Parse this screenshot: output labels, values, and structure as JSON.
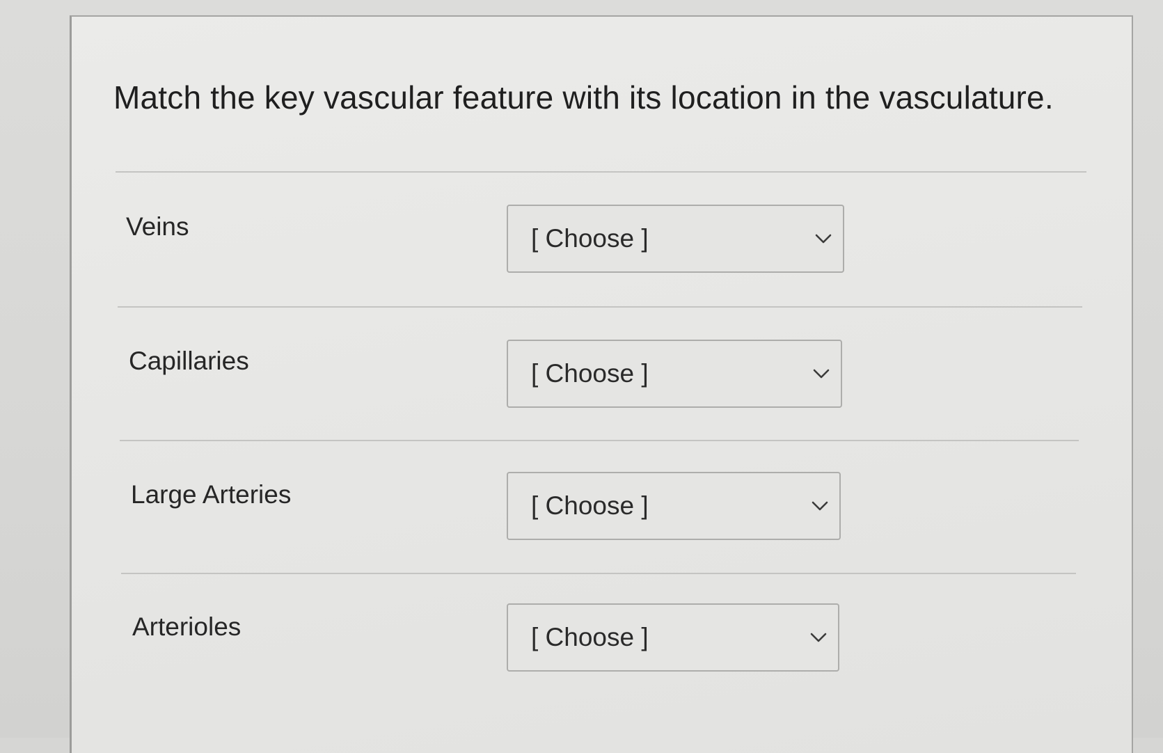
{
  "question": {
    "text": "Match the key vascular feature with its location in the vasculature."
  },
  "matches": [
    {
      "label": "Veins",
      "selected": "[ Choose ]"
    },
    {
      "label": "Capillaries",
      "selected": "[ Choose ]"
    },
    {
      "label": "Large Arteries",
      "selected": "[ Choose ]"
    },
    {
      "label": "Arterioles",
      "selected": "[ Choose ]"
    }
  ],
  "icons": {
    "dropdown": "chevron-down-icon"
  }
}
